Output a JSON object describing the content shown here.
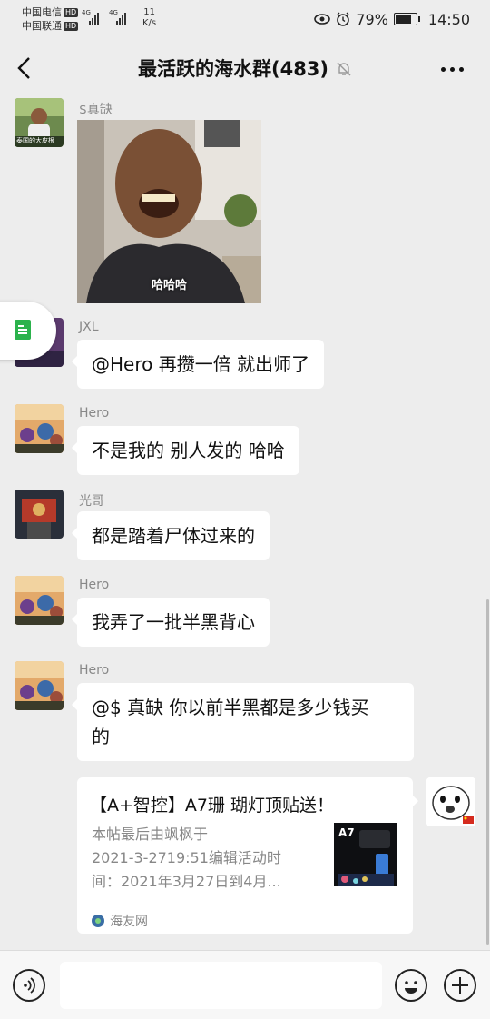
{
  "status_bar": {
    "carrier1": "中国电信",
    "carrier2": "中国联通",
    "hd": "HD",
    "net1": "4G",
    "net2": "4G",
    "speed_value": "11",
    "speed_unit": "K/s",
    "battery": "79%",
    "battery_level": 0.79,
    "time": "14:50"
  },
  "header": {
    "title": "最活跃的海水群(483)"
  },
  "messages": [
    {
      "sender": "$真缺",
      "type": "image",
      "caption": "哈哈哈",
      "avatar_text": "泰国的大皮根"
    },
    {
      "sender": "JXL",
      "text": "@Hero 再攒一倍 就出师了"
    },
    {
      "sender": "Hero",
      "text": "不是我的 别人发的 哈哈"
    },
    {
      "sender": "光哥",
      "text": "都是踏着尸体过来的"
    },
    {
      "sender": "Hero",
      "text": "我弄了一批半黑背心"
    },
    {
      "sender": "Hero",
      "text_line1": "@$ 真缺  你以前半黑都是多少钱买",
      "text_line2": "的"
    }
  ],
  "link_card": {
    "title": "【A+智控】A7珊 瑚灯顶贴送！",
    "desc_line1": "本帖最后由飒枫于",
    "desc_line2": "2021-3-2719:51编辑活动时",
    "desc_line3": "间：2021年3月27日到4月...",
    "thumb_label": "A7",
    "source": "海友网"
  },
  "input": {
    "placeholder": "",
    "value": ""
  },
  "colors": {
    "background": "#ededed",
    "bubble": "#ffffff",
    "sender_gray": "#888888",
    "doc_green": "#2bb24c"
  }
}
